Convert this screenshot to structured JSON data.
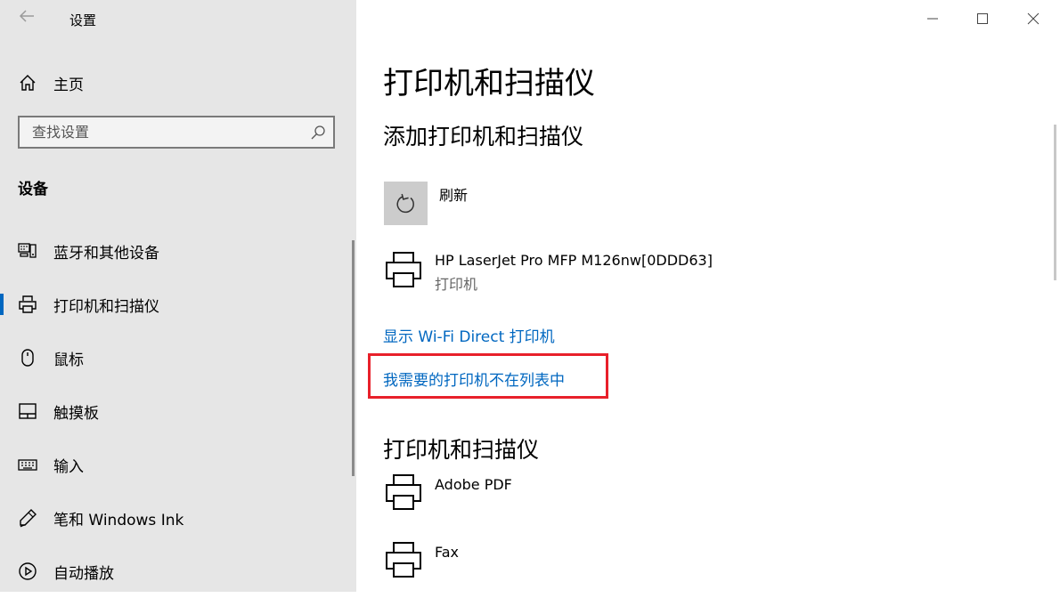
{
  "window": {
    "title": "设置",
    "controls": [
      "minimize-icon",
      "maximize-icon",
      "close-icon"
    ]
  },
  "sidebar": {
    "home_label": "主页",
    "search": {
      "placeholder": "查找设置",
      "value": ""
    },
    "section_title": "设备",
    "items": [
      {
        "label": "蓝牙和其他设备",
        "icon": "bluetooth-devices-icon",
        "selected": false
      },
      {
        "label": "打印机和扫描仪",
        "icon": "printer-icon",
        "selected": true
      },
      {
        "label": "鼠标",
        "icon": "mouse-icon",
        "selected": false
      },
      {
        "label": "触摸板",
        "icon": "touchpad-icon",
        "selected": false
      },
      {
        "label": "输入",
        "icon": "keyboard-icon",
        "selected": false
      },
      {
        "label": "笔和 Windows Ink",
        "icon": "pen-icon",
        "selected": false
      },
      {
        "label": "自动播放",
        "icon": "autoplay-icon",
        "selected": false
      }
    ]
  },
  "main": {
    "title": "打印机和扫描仪",
    "add_section": {
      "title": "添加打印机和扫描仪",
      "refresh_label": "刷新",
      "found_device": {
        "name": "HP LaserJet Pro MFP M126nw[0DDD63]",
        "type": "打印机"
      },
      "links": [
        "显示 Wi-Fi Direct 打印机",
        "我需要的打印机不在列表中"
      ]
    },
    "list_section": {
      "title": "打印机和扫描仪",
      "devices": [
        {
          "name": "Adobe PDF"
        },
        {
          "name": "Fax"
        }
      ]
    }
  },
  "colors": {
    "accent": "#0067c0",
    "sidebar_bg": "#e6e6e6",
    "highlight_box": "#e8202a"
  }
}
